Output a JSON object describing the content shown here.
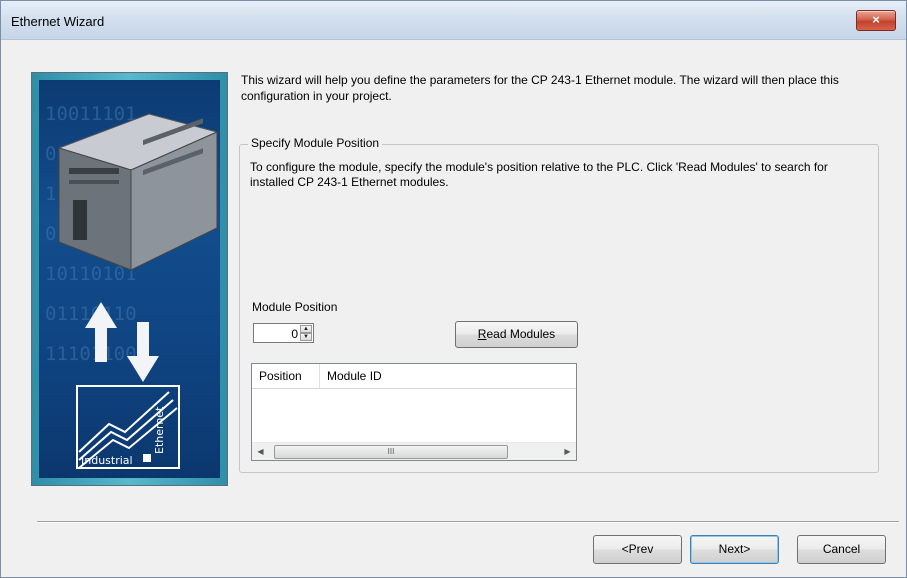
{
  "window": {
    "title": "Ethernet Wizard",
    "close_glyph": "×"
  },
  "graphic": {
    "icon": "plc-module-image",
    "binary_rows": [
      "10011101",
      "01110010",
      "11010101",
      "01010111",
      "10110101",
      "01110110",
      "11101100"
    ],
    "logo_word1": "Industrial",
    "logo_word2": "Ethernet"
  },
  "intro_text": "This wizard will help you define the parameters for the CP 243-1 Ethernet module. The wizard will then place this configuration in your project.",
  "group": {
    "legend": "Specify Module Position",
    "description": "To configure the module, specify the module's position relative to the PLC. Click 'Read Modules' to search for installed CP 243-1 Ethernet modules."
  },
  "module_position": {
    "label": "Module Position",
    "value": "0"
  },
  "read_modules_button": {
    "underlined_char": "R",
    "rest": "ead Modules"
  },
  "module_list": {
    "columns": [
      "Position",
      "Module ID"
    ],
    "rows": [],
    "scroll_thumb_glyph": "III"
  },
  "buttons": {
    "prev": "<Prev",
    "next": "Next>",
    "cancel": "Cancel"
  },
  "colors": {
    "title_bar": "#d4e0ef",
    "close_button": "#c94a33",
    "background": "#f0f0f0",
    "graphic_inner": "#134d8c",
    "graphic_frame": "#3ea2b8"
  }
}
